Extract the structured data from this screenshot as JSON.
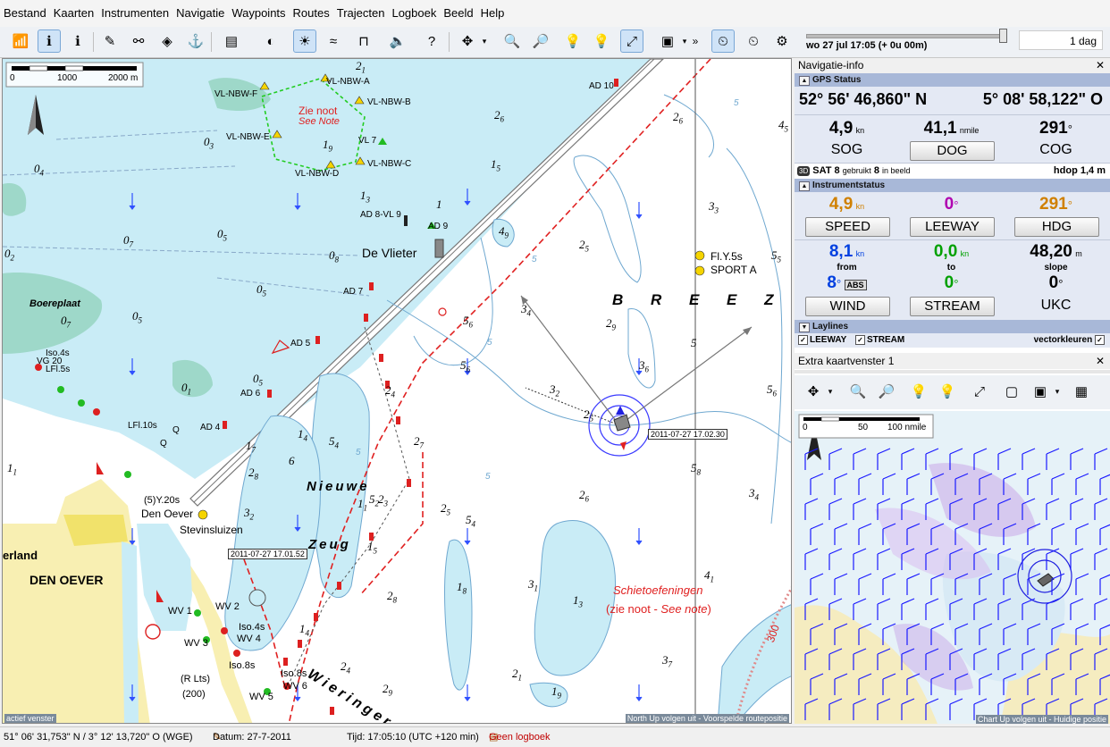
{
  "menu": [
    "Bestand",
    "Kaarten",
    "Instrumenten",
    "Navigatie",
    "Waypoints",
    "Routes",
    "Trajecten",
    "Logboek",
    "Beeld",
    "Help"
  ],
  "toolbar": {
    "more": "»",
    "time": "wo 27 jul 17:05  (+ 0u 00m)",
    "period": "1 dag"
  },
  "chart": {
    "scale": [
      "0",
      "1000",
      "2000 m"
    ],
    "places": [
      "De Vlieter",
      "DEN OEVER",
      "Den Oever",
      "Stevinsluizen",
      "Boereplaat",
      "erland"
    ],
    "water_names": [
      "B R E E Z A",
      "Nieuwe",
      "Zeug",
      "Wieringer"
    ],
    "note": {
      "nl": "Zie noot",
      "en": "See Note"
    },
    "schiet": {
      "line1": "Schietoefeningen",
      "line2a": "(zie noot - ",
      "line2b": "See note",
      ")": ")"
    },
    "buoys": [
      "VL-NBW-A",
      "VL-NBW-B",
      "VL-NBW-F",
      "VL-NBW-E",
      "VL 7",
      "VL-NBW-C",
      "VL-NBW-D",
      "AD 10",
      "AD 8-VL 9",
      "AD 9",
      "AD 7",
      "AD 5",
      "AD 6",
      "AD 4",
      "Fl.Y.5s",
      "SPORT A",
      "WV 1",
      "WV 2",
      "WV 3",
      "WV 4",
      "WV 5",
      "WV 6",
      "Iso.4s",
      "Iso.8s",
      "Iso.8s",
      "(R Lts)",
      "(200)",
      "(5)Y.20s",
      "LFl.10s",
      "Q",
      "Q",
      "LFl.5s",
      "Iso.4s",
      "VG 20"
    ],
    "depths": [
      {
        "t": "2",
        "s": "1"
      },
      {
        "t": "2",
        "s": "6"
      },
      {
        "t": "1",
        "s": "5"
      },
      {
        "t": "0",
        "s": "3"
      },
      {
        "t": "1",
        "s": "9"
      },
      {
        "t": "0",
        "s": "4"
      },
      {
        "t": "1",
        "s": "3"
      },
      {
        "t": "1",
        "s": ""
      },
      {
        "t": "0",
        "s": "5"
      },
      {
        "t": "0",
        "s": "7"
      },
      {
        "t": "0",
        "s": "2"
      },
      {
        "t": "0",
        "s": "8"
      },
      {
        "t": "0",
        "s": "5"
      },
      {
        "t": "0",
        "s": "7"
      },
      {
        "t": "0",
        "s": "5"
      },
      {
        "t": "0",
        "s": "1"
      },
      {
        "t": "0",
        "s": "5"
      },
      {
        "t": "5",
        "s": "6"
      },
      {
        "t": "2",
        "s": "6"
      },
      {
        "t": "3",
        "s": "3"
      },
      {
        "t": "4",
        "s": "5"
      },
      {
        "t": "5",
        "s": "5"
      },
      {
        "t": "4",
        "s": "9"
      },
      {
        "t": "2",
        "s": "5"
      },
      {
        "t": "3",
        "s": "4"
      },
      {
        "t": "2",
        "s": "9"
      },
      {
        "t": "5",
        "s": "6"
      },
      {
        "t": "5",
        "s": ""
      },
      {
        "t": "3",
        "s": "6"
      },
      {
        "t": "5",
        "s": "6"
      },
      {
        "t": "3",
        "s": "2"
      },
      {
        "t": "2",
        "s": "5"
      },
      {
        "t": "5",
        "s": "8"
      },
      {
        "t": "3",
        "s": "4"
      },
      {
        "t": "2",
        "s": "6"
      },
      {
        "t": "5",
        "s": "2"
      },
      {
        "t": "1",
        "s": "5"
      },
      {
        "t": "4",
        "s": "1"
      },
      {
        "t": "3",
        "s": "1"
      },
      {
        "t": "1",
        "s": "3"
      },
      {
        "t": "1",
        "s": "8"
      },
      {
        "t": "2",
        "s": "4"
      },
      {
        "t": "2",
        "s": "7"
      },
      {
        "t": "2",
        "s": "3"
      },
      {
        "t": "1",
        "s": "4"
      },
      {
        "t": "5",
        "s": "4"
      },
      {
        "t": "1",
        "s": "7"
      },
      {
        "t": "2",
        "s": "8"
      },
      {
        "t": "6",
        "s": ""
      },
      {
        "t": "1",
        "s": "1"
      },
      {
        "t": "2",
        "s": "5"
      },
      {
        "t": "5",
        "s": "4"
      },
      {
        "t": "3",
        "s": "2"
      },
      {
        "t": "2",
        "s": "8"
      },
      {
        "t": "1",
        "s": "4"
      },
      {
        "t": "2",
        "s": "4"
      },
      {
        "t": "2",
        "s": "9"
      },
      {
        "t": "2",
        "s": "1"
      },
      {
        "t": "1",
        "s": "9"
      },
      {
        "t": "3",
        "s": "7"
      },
      {
        "t": "1",
        "s": "1"
      }
    ],
    "track_labels": [
      "2011-07-27 17.02.30",
      "2011-07-27 17.01.52"
    ],
    "contour_5": "5",
    "range_300": "300",
    "footer_right": "North Up volgen uit - Voorspelde routepositie",
    "footer_left": "actief venster"
  },
  "nav": {
    "title": "Navigatie-info",
    "gps_section": "GPS Status",
    "lat": "52° 56' 46,860\" N",
    "lon": "5° 08' 58,122\" O",
    "sog": {
      "value": "4,9",
      "unit": "kn",
      "label": "SOG"
    },
    "dog": {
      "value": "41,1",
      "unit": "nmile",
      "label": "DOG"
    },
    "cog": {
      "value": "291",
      "unit": "°",
      "label": "COG"
    },
    "sat": {
      "badge": "3D",
      "label": "SAT",
      "used": "8",
      "used_txt": "gebruikt",
      "visible": "8",
      "visible_txt": "in beeld",
      "hdop_label": "hdop",
      "hdop": "1,4 m"
    },
    "instr_section": "Instrumentstatus",
    "speed": {
      "value": "4,9",
      "unit": "kn",
      "label": "SPEED",
      "color": "#d08000"
    },
    "leeway": {
      "value": "0",
      "unit": "°",
      "label": "LEEWAY",
      "color": "#b000b0"
    },
    "hdg": {
      "value": "291",
      "unit": "°",
      "label": "HDG",
      "color": "#d08000"
    },
    "wind": {
      "value": "8,1",
      "unit": "kn",
      "sub": "from",
      "dir": "8",
      "dir_unit": "°",
      "abs": "ABS",
      "label": "WIND",
      "color": "#0040e0"
    },
    "stream": {
      "value": "0,0",
      "unit": "kn",
      "sub": "to",
      "dir": "0",
      "dir_unit": "°",
      "label": "STREAM",
      "color": "#00a000"
    },
    "ukc": {
      "value": "48,20",
      "unit": "m",
      "sub": "slope",
      "dir": "0",
      "dir_unit": "°",
      "label": "UKC"
    },
    "laylines_section": "Laylines",
    "laylines": {
      "leeway": "LEEWAY",
      "stream": "STREAM",
      "vector": "vectorkleuren"
    }
  },
  "extra": {
    "title": "Extra kaartvenster 1",
    "scale": [
      "0",
      "50",
      "100 nmile"
    ],
    "footer": "Chart Up volgen uit - Huidige positie"
  },
  "status": {
    "position": "51° 06' 31,753\" N / 3° 12' 13,720\" O (WGE)",
    "date": "Datum: 27-7-2011",
    "time": "Tijd: 17:05:10 (UTC +120 min)",
    "log": "Geen logboek"
  }
}
